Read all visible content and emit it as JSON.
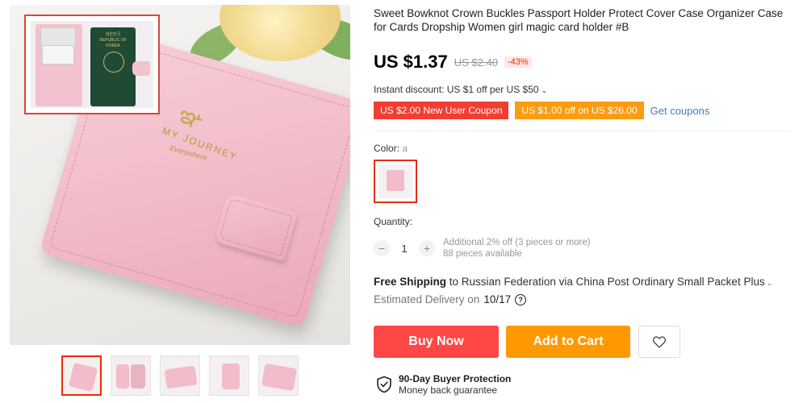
{
  "product": {
    "title": "Sweet Bowknot Crown Buckles Passport Holder Protect Cover Case Organizer Case for Cards Dropship Women girl magic card holder #B"
  },
  "gallery": {
    "product_lettering": {
      "brand": "MY JOURNEY",
      "subtitle": "Everywhere"
    },
    "thumbnails": [
      {
        "name": "thumb-1",
        "active": true
      },
      {
        "name": "thumb-2",
        "active": false
      },
      {
        "name": "thumb-3",
        "active": false
      },
      {
        "name": "thumb-4",
        "active": false
      },
      {
        "name": "thumb-5",
        "active": false
      }
    ]
  },
  "price": {
    "current": "US $1.37",
    "original": "US $2.40",
    "discount": "-43%"
  },
  "instant_discount": "Instant discount: US $1 off per US $50",
  "coupons": {
    "new_user": "US $2.00 New User Coupon",
    "off": "US $1.00 off on US $26.00",
    "get_label": "Get coupons"
  },
  "color": {
    "label": "Color:",
    "value": "a"
  },
  "quantity": {
    "label": "Quantity:",
    "value": "1",
    "minus": "−",
    "plus": "+",
    "additional": "Additional 2% off (3 pieces or more)",
    "available": "88 pieces available"
  },
  "shipping": {
    "bold": "Free Shipping",
    "rest": "to Russian Federation via China Post Ordinary Small Packet Plus",
    "delivery_label": "Estimated Delivery on",
    "delivery_date": "10/17"
  },
  "actions": {
    "buy_now": "Buy Now",
    "add_to_cart": "Add to Cart"
  },
  "protection": {
    "title": "90-Day Buyer Protection",
    "subtitle": "Money back guarantee"
  },
  "colors": {
    "accent_red": "#ff4747",
    "accent_orange": "#ff9900",
    "link_blue": "#3d7dc6"
  }
}
